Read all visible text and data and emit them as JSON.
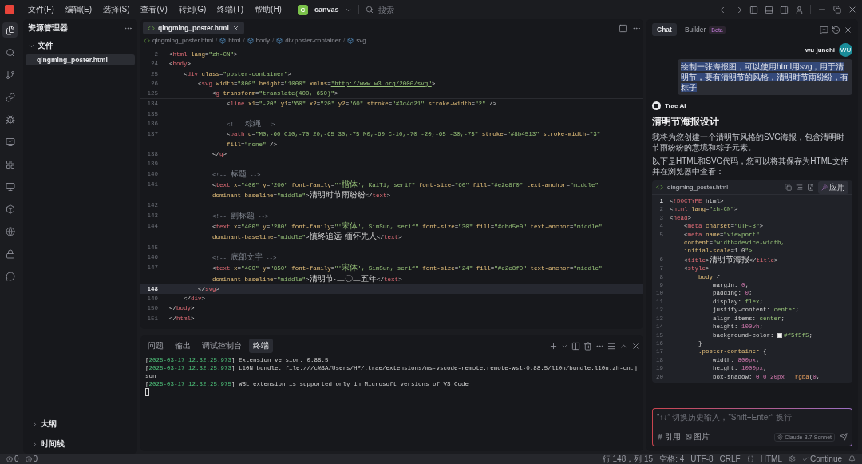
{
  "title_bar": {
    "menu": [
      "文件(F)",
      "编辑(E)",
      "选择(S)",
      "查看(V)",
      "转到(G)",
      "终端(T)",
      "帮助(H)"
    ],
    "project_badge": "C",
    "project": "canvas",
    "search_placeholder": "搜索"
  },
  "activity_bar": [
    {
      "kind": "files",
      "selected": true
    },
    {
      "kind": "search",
      "selected": false
    },
    {
      "kind": "git",
      "selected": false
    },
    {
      "kind": "remote",
      "selected": false
    },
    {
      "kind": "debug",
      "selected": false
    },
    {
      "kind": "preview",
      "selected": false
    },
    {
      "kind": "grid",
      "selected": false
    },
    {
      "kind": "monitor",
      "selected": false
    },
    {
      "kind": "box",
      "selected": false
    },
    {
      "kind": "globe",
      "selected": false
    },
    {
      "kind": "lock",
      "selected": false
    },
    {
      "kind": "chat",
      "selected": false
    }
  ],
  "explorer": {
    "title": "资源管理器",
    "section": "文件",
    "section_expanded": true,
    "files": [
      {
        "name": "qingming_poster.html",
        "selected": true
      }
    ],
    "bottom_sections": [
      {
        "label": "大纲",
        "expanded": false
      },
      {
        "label": "时间线",
        "expanded": false
      }
    ]
  },
  "editor": {
    "tabs": [
      {
        "label": "qingming_poster.html",
        "selected": true
      }
    ],
    "breadcrumb": [
      "qingming_poster.html",
      "html",
      "body",
      "div.poster-container",
      "svg"
    ],
    "breadcrumb_separator": "/",
    "sticky_lines": [
      {
        "number": "2",
        "rows": [
          "<html lang=\"zh-CN\">"
        ]
      },
      {
        "number": "24",
        "rows": [
          "<body>"
        ]
      },
      {
        "number": "25",
        "rows": [
          "    <div class=\"poster-container\">"
        ]
      },
      {
        "number": "26",
        "rows": [
          "        <svg width=\"800\" height=\"1000\" xmlns=\"http://www.w3.org/2000/svg\">"
        ]
      },
      {
        "number": "125",
        "rows": [
          "            <g transform=\"translate(400, 650)\">"
        ]
      }
    ],
    "lines": [
      {
        "number": "134",
        "current": false,
        "rows": [
          "                <line x1=\"-20\" y1=\"60\" x2=\"20\" y2=\"60\" stroke=\"#3c4d21\" stroke-width=\"2\" />"
        ]
      },
      {
        "number": "135",
        "current": false
      },
      {
        "number": "136",
        "current": false,
        "rows": [
          "                <!-- 粽绳 -->"
        ]
      },
      {
        "number": "137",
        "current": false,
        "rows": [
          "                <path d=\"M0,-60 C10,-70 20,-65 30,-75 M0,-60 C-10,-70 -20,-65 -30,-75\" stroke=\"#8b4513\" stroke-width=\"3\"",
          "                fill=\"none\" />"
        ]
      },
      {
        "number": "138",
        "current": false,
        "rows": [
          "            </g>"
        ]
      },
      {
        "number": "139",
        "current": false
      },
      {
        "number": "140",
        "current": false,
        "rows": [
          "            <!-- 标题 -->"
        ]
      },
      {
        "number": "141",
        "current": false,
        "rows": [
          "            <text x=\"400\" y=\"200\" font-family=\"'楷体', KaiTi, serif\" font-size=\"60\" fill=\"#e2e8f0\" text-anchor=\"middle\"",
          "            dominant-baseline=\"middle\">清明时节雨纷纷</text>"
        ]
      },
      {
        "number": "142",
        "current": false
      },
      {
        "number": "143",
        "current": false,
        "rows": [
          "            <!-- 副标题 -->"
        ]
      },
      {
        "number": "144",
        "current": false,
        "rows": [
          "            <text x=\"400\" y=\"280\" font-family=\"'宋体', SimSun, serif\" font-size=\"30\" fill=\"#cbd5e0\" text-anchor=\"middle\"",
          "            dominant-baseline=\"middle\">慎终追远 缅怀先人</text>"
        ]
      },
      {
        "number": "145",
        "current": false
      },
      {
        "number": "146",
        "current": false,
        "rows": [
          "            <!-- 底部文字 -->"
        ]
      },
      {
        "number": "147",
        "current": false,
        "rows": [
          "            <text x=\"400\" y=\"850\" font-family=\"'宋体', SimSun, serif\" font-size=\"24\" fill=\"#e2e8f0\" text-anchor=\"middle\"",
          "            dominant-baseline=\"middle\">清明节·二〇二五年</text>"
        ]
      },
      {
        "number": "148",
        "current": true,
        "rows": [
          "        </svg>"
        ]
      },
      {
        "number": "149",
        "current": false,
        "rows": [
          "    </div>"
        ]
      },
      {
        "number": "150",
        "current": false,
        "rows": [
          "</body>"
        ]
      },
      {
        "number": "151",
        "current": false,
        "rows": [
          "</html>"
        ]
      }
    ]
  },
  "panel": {
    "tabs": [
      {
        "label": "问题",
        "selected": false
      },
      {
        "label": "输出",
        "selected": false
      },
      {
        "label": "调试控制台",
        "selected": false
      },
      {
        "label": "终端",
        "selected": true
      }
    ],
    "terminal_lines": [
      {
        "time": "[2025-03-17 12:32:25.973]",
        "text": "Extension version: 0.88.5"
      },
      {
        "time": "[2025-03-17 12:32:25.973]",
        "text": "L10N bundle: file:///c%3A/Users/HP/.trae/extensions/ms-vscode-remote.remote-wsl-0.88.5/l10n/bundle.l10n.zh-cn.j"
      },
      {
        "text": "son"
      },
      {
        "time": "[2025-03-17 12:32:25.975]",
        "text": "WSL extension is supported only in Microsoft versions of VS Code"
      }
    ]
  },
  "chat": {
    "tabs": [
      {
        "label": "Chat",
        "selected": true
      },
      {
        "label": "Builder",
        "badge": "Beta",
        "selected": false
      }
    ],
    "user": {
      "name": "wu junchi",
      "avatar": "WU",
      "message": "绘制一张海报图，可以使用html用svg，用于清明节，要有清明节的风格，清明时节雨纷纷，有粽子"
    },
    "assistant": {
      "name": "Trae AI",
      "heading": "清明节海报设计",
      "paragraphs": [
        "我将为您创建一个清明节风格的SVG海报，包含清明时节雨纷纷的意境和粽子元素。",
        "以下是HTML和SVG代码，您可以将其保存为HTML文件并在浏览器中查看："
      ],
      "code_block": {
        "filename": "qingming_poster.html",
        "apply": "应用",
        "lines": [
          {
            "number": "1",
            "current": true,
            "rows": [
              "<!DOCTYPE html>"
            ]
          },
          {
            "number": "2",
            "current": false,
            "rows": [
              "<html lang=\"zh-CN\">"
            ]
          },
          {
            "number": "3",
            "current": false,
            "rows": [
              "<head>"
            ]
          },
          {
            "number": "4",
            "current": false,
            "rows": [
              "    <meta charset=\"UTF-8\">"
            ]
          },
          {
            "number": "5",
            "current": false,
            "rows": [
              "    <meta name=\"viewport\"",
              "    content=\"width=device-width,",
              "    initial-scale=1.0\">"
            ]
          },
          {
            "number": "6",
            "current": false,
            "rows": [
              "    <title>清明节海报</title>"
            ]
          },
          {
            "number": "7",
            "current": false,
            "rows": [
              "    <style>"
            ]
          },
          {
            "number": "8",
            "current": false,
            "rows": [
              "        body {"
            ]
          },
          {
            "number": "9",
            "current": false,
            "rows": [
              "            margin: 0;"
            ]
          },
          {
            "number": "10",
            "current": false,
            "rows": [
              "            padding: 0;"
            ]
          },
          {
            "number": "11",
            "current": false,
            "rows": [
              "            display: flex;"
            ]
          },
          {
            "number": "12",
            "current": false,
            "rows": [
              "            justify-content: center;"
            ]
          },
          {
            "number": "13",
            "current": false,
            "rows": [
              "            align-items: center;"
            ]
          },
          {
            "number": "14",
            "current": false,
            "rows": [
              "            height: 100vh;"
            ]
          },
          {
            "number": "15",
            "current": false,
            "rows": [
              "            background-color: #f5f5f5;"
            ]
          },
          {
            "number": "16",
            "current": false,
            "rows": [
              "        }"
            ]
          },
          {
            "number": "17",
            "current": false,
            "rows": [
              "        .poster-container {"
            ]
          },
          {
            "number": "18",
            "current": false,
            "rows": [
              "            width: 800px;"
            ]
          },
          {
            "number": "19",
            "current": false,
            "rows": [
              "            height: 1000px;"
            ]
          },
          {
            "number": "20",
            "current": false,
            "rows": [
              "            box-shadow: 0 0 20px rgba(0,"
            ]
          }
        ]
      }
    },
    "input": {
      "placeholder": "“↑↓” 切换历史输入，“Shift+Enter” 换行",
      "reference": "引用",
      "image": "图片",
      "model": "Claude-3.7-Sonnet"
    }
  },
  "status_bar": {
    "errors": "0",
    "warnings": "0",
    "position": "行 148，列 15",
    "spaces": "空格: 4",
    "encoding": "UTF-8",
    "eol": "CRLF",
    "language": "HTML",
    "continue": "Continue"
  }
}
